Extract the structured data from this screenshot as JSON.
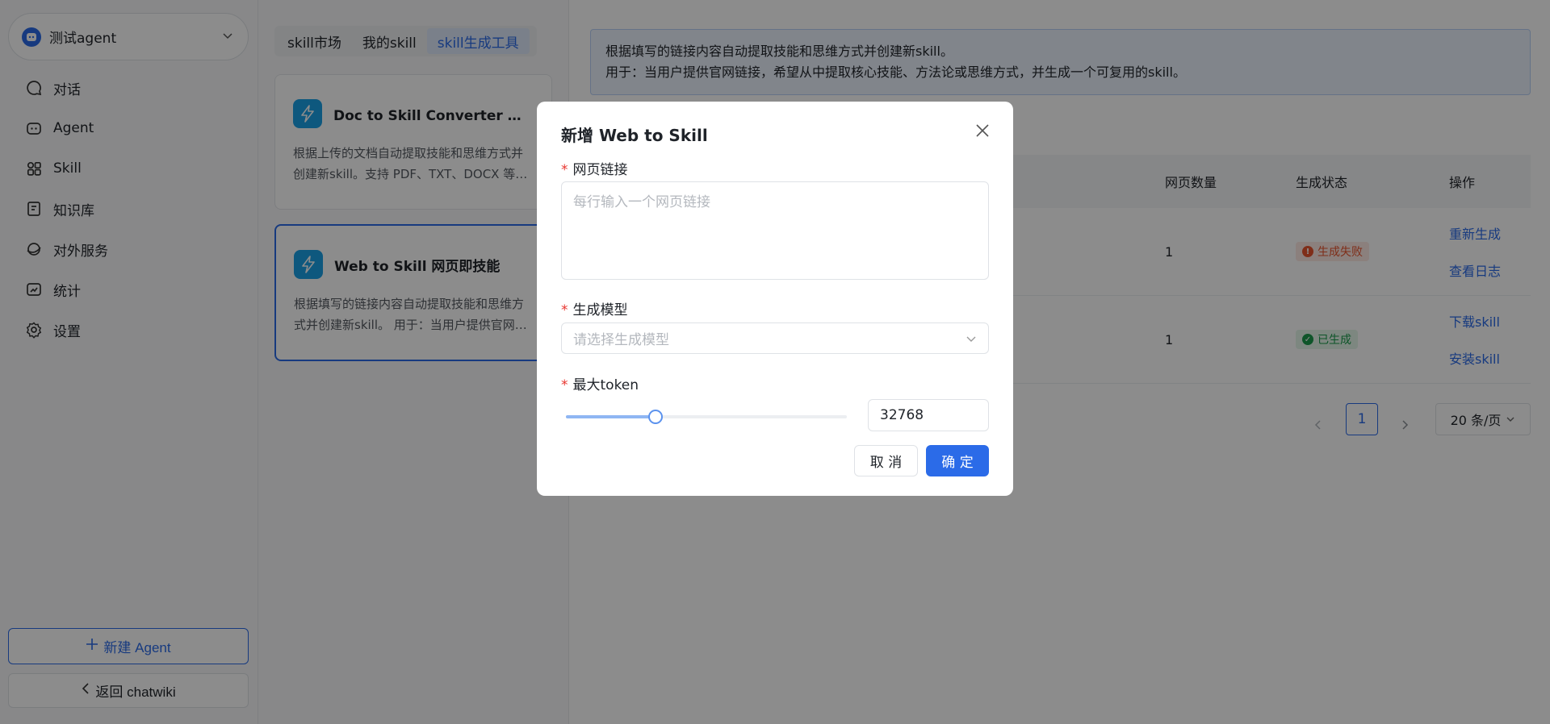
{
  "sidebar": {
    "agent_name": "测试agent",
    "nav": [
      {
        "label": "对话",
        "icon": "chat-icon"
      },
      {
        "label": "Agent",
        "icon": "robot-icon"
      },
      {
        "label": "Skill",
        "icon": "grid-icon"
      },
      {
        "label": "知识库",
        "icon": "book-icon"
      },
      {
        "label": "对外服务",
        "icon": "api-icon"
      },
      {
        "label": "统计",
        "icon": "chart-icon"
      },
      {
        "label": "设置",
        "icon": "gear-icon"
      }
    ],
    "new_agent_label": "新建 Agent",
    "back_label": "返回 chatwiki"
  },
  "tabs": [
    "skill市场",
    "我的skill",
    "skill生成工具"
  ],
  "active_tab": 2,
  "tool_cards": [
    {
      "title": "Doc to Skill Converter 书籍/文档转技能",
      "desc": "根据上传的文档自动提取技能和思维方式并创建新skill。支持 PDF、TXT、DOCX 等格式文档。"
    },
    {
      "title": "Web to Skill 网页即技能",
      "desc": "根据填写的链接内容自动提取技能和思维方式并创建新skill。 用于：当用户提供官网链接时使用。"
    }
  ],
  "info": {
    "line1": "根据填写的链接内容自动提取技能和思维方式并创建新skill。",
    "line2": "用于：当用户提供官网链接，希望从中提取核心技能、方法论或思维方式，并生成一个可复用的skill。"
  },
  "table": {
    "headers": [
      "网页数量",
      "生成状态",
      "操作"
    ],
    "rows": [
      {
        "pages": "1",
        "status": "生成失败",
        "status_type": "fail",
        "actions": [
          "重新生成",
          "查看日志"
        ]
      },
      {
        "pages": "1",
        "status": "已生成",
        "status_type": "ok",
        "actions": [
          "下载skill",
          "安装skill"
        ]
      }
    ]
  },
  "pagination": {
    "current": "1",
    "page_size": "20 条/页"
  },
  "modal": {
    "title": "新增 Web to Skill",
    "url_label": "网页链接",
    "url_placeholder": "每行输入一个网页链接",
    "model_label": "生成模型",
    "model_placeholder": "请选择生成模型",
    "token_label": "最大token",
    "token_value": "32768",
    "token_fraction": 0.32,
    "cancel_label": "取 消",
    "confirm_label": "确 定"
  },
  "colors": {
    "accent": "#2b6be8",
    "fail": "#e8552f",
    "ok": "#1a9b4b"
  }
}
